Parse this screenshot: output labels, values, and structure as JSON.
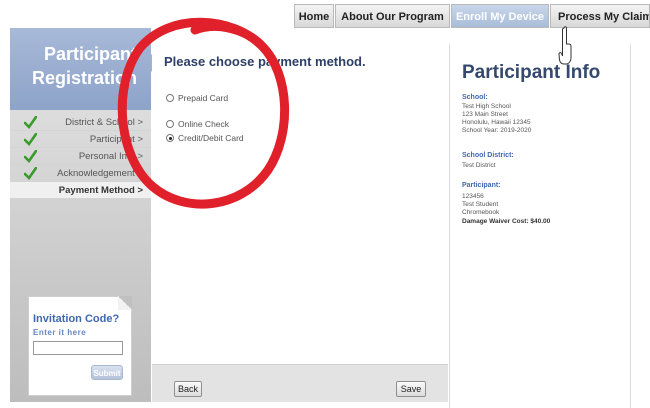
{
  "nav": {
    "home": "Home",
    "about": "About Our Program",
    "enroll": "Enroll My Device",
    "claim": "Process My Claim"
  },
  "sidebar": {
    "title_line1": "Participant",
    "title_line2": "Registration",
    "steps": [
      {
        "label": "District & School >",
        "done": true
      },
      {
        "label": "Participant >",
        "done": true
      },
      {
        "label": "Personal Info >",
        "done": true
      },
      {
        "label": "Acknowledgement >",
        "done": true
      },
      {
        "label": "Payment Method >",
        "done": false,
        "active": true
      }
    ],
    "invitation": {
      "title": "Invitation Code?",
      "subtitle": "Enter it here",
      "input_value": "",
      "submit_label": "Submit"
    }
  },
  "main": {
    "heading": "Please choose payment method.",
    "options": [
      {
        "label": "Prepaid Card",
        "checked": false
      },
      {
        "label": "Online Check",
        "checked": false
      },
      {
        "label": "Credit/Debit Card",
        "checked": true
      }
    ],
    "back_label": "Back",
    "save_label": "Save"
  },
  "info": {
    "title": "Participant Info",
    "school_label": "School:",
    "school_lines": [
      "Test High School",
      "123 Main Street",
      "Honolulu, Hawaii 12345",
      "School Year: 2019-2020"
    ],
    "district_label": "School District:",
    "district_lines": [
      "Test District"
    ],
    "participant_label": "Participant:",
    "participant_lines": [
      "123456",
      "Test Student",
      "Chromebook"
    ],
    "damage_waiver": "Damage Waiver Cost: $40.00"
  },
  "colors": {
    "accent_blue": "#8da3c9",
    "heading_navy": "#2e3f66",
    "check_green": "#3a9a2c",
    "annotation_red": "#e0202a"
  }
}
